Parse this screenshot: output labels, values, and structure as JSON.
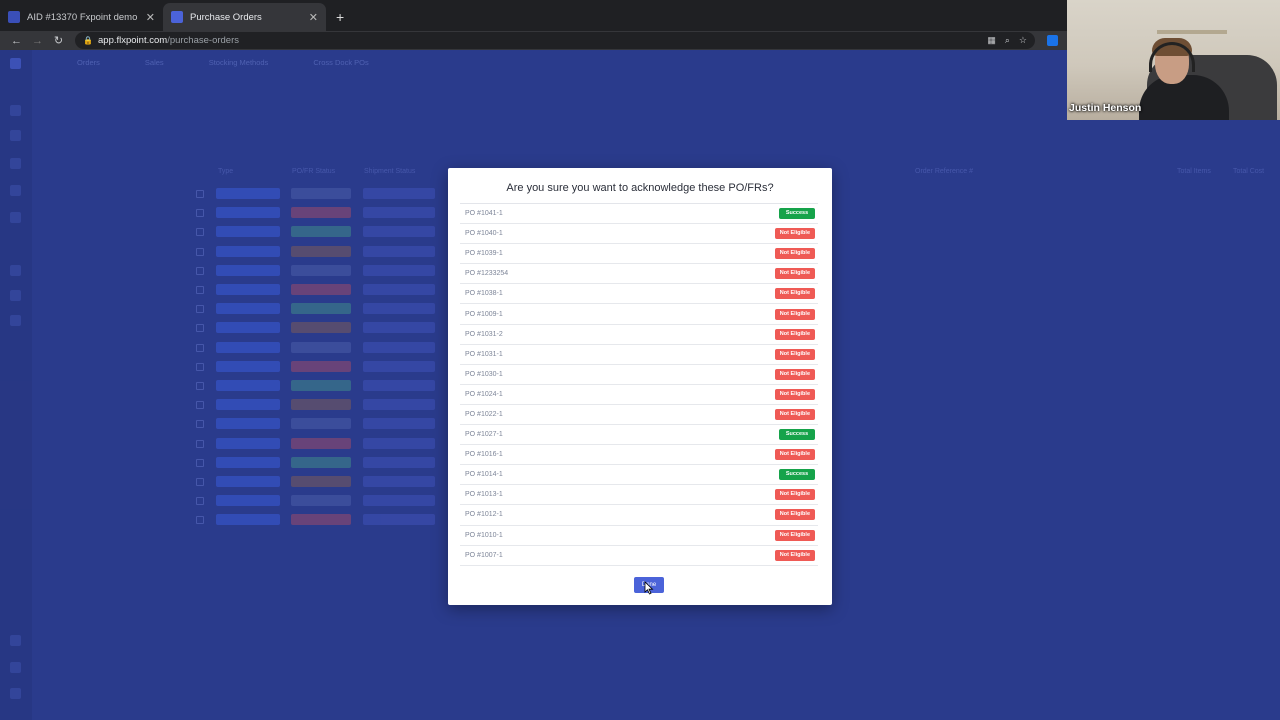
{
  "browser": {
    "tabs": [
      {
        "title": "AID #13370 Fxpoint demo",
        "active": false,
        "favicon_color": "#3a4fb8"
      },
      {
        "title": "Purchase Orders",
        "active": true,
        "favicon_color": "#4b63d9"
      }
    ],
    "new_tab": "+",
    "address": {
      "host": "app.flxpoint.com",
      "path": "/purchase-orders"
    }
  },
  "webcam": {
    "participant_name": "Justin Henson"
  },
  "modal": {
    "title": "Are you sure you want to acknowledge these PO/FRs?",
    "rows": [
      {
        "po": "PO #1041-1",
        "status": "Success",
        "kind": "success"
      },
      {
        "po": "PO #1040-1",
        "status": "Not Eligible",
        "kind": "fail"
      },
      {
        "po": "PO #1039-1",
        "status": "Not Eligible",
        "kind": "fail"
      },
      {
        "po": "PO #1233254",
        "status": "Not Eligible",
        "kind": "fail"
      },
      {
        "po": "PO #1038-1",
        "status": "Not Eligible",
        "kind": "fail"
      },
      {
        "po": "PO #1009-1",
        "status": "Not Eligible",
        "kind": "fail"
      },
      {
        "po": "PO #1031-2",
        "status": "Not Eligible",
        "kind": "fail"
      },
      {
        "po": "PO #1031-1",
        "status": "Not Eligible",
        "kind": "fail"
      },
      {
        "po": "PO #1030-1",
        "status": "Not Eligible",
        "kind": "fail"
      },
      {
        "po": "PO #1024-1",
        "status": "Not Eligible",
        "kind": "fail"
      },
      {
        "po": "PO #1022-1",
        "status": "Not Eligible",
        "kind": "fail"
      },
      {
        "po": "PO #1027-1",
        "status": "Success",
        "kind": "success"
      },
      {
        "po": "PO #1016-1",
        "status": "Not Eligible",
        "kind": "fail"
      },
      {
        "po": "PO #1014-1",
        "status": "Success",
        "kind": "success"
      },
      {
        "po": "PO #1013-1",
        "status": "Not Eligible",
        "kind": "fail"
      },
      {
        "po": "PO #1012-1",
        "status": "Not Eligible",
        "kind": "fail"
      },
      {
        "po": "PO #1010-1",
        "status": "Not Eligible",
        "kind": "fail"
      },
      {
        "po": "PO #1007-1",
        "status": "Not Eligible",
        "kind": "fail"
      }
    ],
    "done_label": "Done"
  },
  "background": {
    "topnav": [
      "Orders",
      "Sales",
      "Stocking Methods",
      "Cross Dock POs"
    ],
    "table_headers": [
      "Type",
      "PO/FR Status",
      "Shipment Status",
      "Order Reference #",
      "Total Items",
      "Total Cost"
    ]
  },
  "colors": {
    "accent": "#4b63d9",
    "success": "#16a34a",
    "not_eligible": "#ef5a55",
    "overlay": "#2a3b8c"
  },
  "icons": [
    "back-icon",
    "forward-icon",
    "reload-icon",
    "lock-icon",
    "qr-icon",
    "zoom-icon",
    "star-icon",
    "extension-icon",
    "close-icon",
    "cursor-icon"
  ]
}
